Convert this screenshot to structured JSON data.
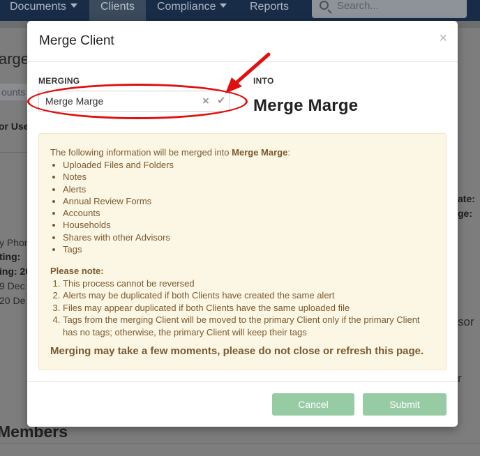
{
  "nav": {
    "items": [
      {
        "label": "Documents",
        "dropdown": true
      },
      {
        "label": "Clients",
        "active": true
      },
      {
        "label": "Compliance",
        "dropdown": true
      },
      {
        "label": "Reports"
      }
    ],
    "search_placeholder": "Search..."
  },
  "background": {
    "page_title_fragment": "arge",
    "tab_fragment": "ounts",
    "left_label": "or Use",
    "phone_fragment": "y Phon",
    "setting_fragment": "ting:",
    "ing_fragment": "ing: 20",
    "date1_fragment": "9 Dec",
    "date2_fragment": "20 De",
    "right_date": "ate:",
    "right_age": "ge:",
    "right_advisor": "sor",
    "right_r": "r",
    "members_heading": "Members"
  },
  "modal": {
    "title": "Merge Client",
    "close_symbol": "×",
    "merging_label": "MERGING",
    "merging_value": "Merge Marge",
    "into_label": "INTO",
    "into_value": "Merge Marge",
    "info": {
      "intro_prefix": "The following information will be merged into ",
      "intro_target": "Merge Marge",
      "intro_suffix": ":",
      "items": [
        "Uploaded Files and Folders",
        "Notes",
        "Alerts",
        "Annual Review Forms",
        "Accounts",
        "Households",
        "Shares with other Advisors",
        "Tags"
      ],
      "note_title": "Please note:",
      "notes": [
        "This process cannot be reversed",
        "Alerts may be duplicated if both Clients have created the same alert",
        "Files may appear duplicated if both Clients have the same uploaded file",
        "Tags from the merging Client will be moved to the primary Client only if the primary Client has no tags; otherwise, the primary Client will keep their tags"
      ],
      "warning": "Merging may take a few moments, please do not close or refresh this page."
    },
    "cancel_label": "Cancel",
    "submit_label": "Submit"
  },
  "colors": {
    "nav_bg": "#182c48",
    "info_bg": "#fcf6e4",
    "info_text": "#7a5a2f",
    "button_green": "#97cba4",
    "highlight_red": "#e01010"
  }
}
